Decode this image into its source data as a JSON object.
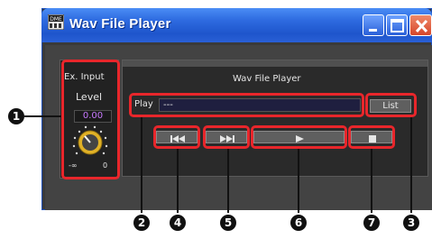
{
  "window": {
    "title": "Wav File Player",
    "icon": "dme-app-icon"
  },
  "input": {
    "title": "Ex. Input",
    "level_label": "Level",
    "level_value": "0.00",
    "min_label": "-∞",
    "max_label": "0"
  },
  "player": {
    "title": "Wav File Player",
    "play_label": "Play",
    "play_value": "---",
    "list_label": "List"
  },
  "callouts": [
    "1",
    "2",
    "4",
    "5",
    "6",
    "7",
    "3"
  ],
  "colors": {
    "highlight": "#e8262b",
    "titlebar": "#2e6be0",
    "value_text": "#c87aff"
  }
}
